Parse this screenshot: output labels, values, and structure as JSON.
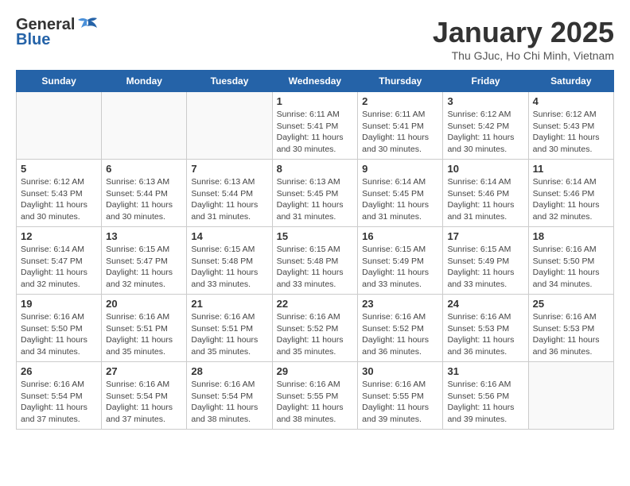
{
  "header": {
    "logo_general": "General",
    "logo_blue": "Blue",
    "title": "January 2025",
    "subtitle": "Thu GJuc, Ho Chi Minh, Vietnam"
  },
  "days_of_week": [
    "Sunday",
    "Monday",
    "Tuesday",
    "Wednesday",
    "Thursday",
    "Friday",
    "Saturday"
  ],
  "weeks": [
    [
      {
        "day": "",
        "info": ""
      },
      {
        "day": "",
        "info": ""
      },
      {
        "day": "",
        "info": ""
      },
      {
        "day": "1",
        "info": "Sunrise: 6:11 AM\nSunset: 5:41 PM\nDaylight: 11 hours\nand 30 minutes."
      },
      {
        "day": "2",
        "info": "Sunrise: 6:11 AM\nSunset: 5:41 PM\nDaylight: 11 hours\nand 30 minutes."
      },
      {
        "day": "3",
        "info": "Sunrise: 6:12 AM\nSunset: 5:42 PM\nDaylight: 11 hours\nand 30 minutes."
      },
      {
        "day": "4",
        "info": "Sunrise: 6:12 AM\nSunset: 5:43 PM\nDaylight: 11 hours\nand 30 minutes."
      }
    ],
    [
      {
        "day": "5",
        "info": "Sunrise: 6:12 AM\nSunset: 5:43 PM\nDaylight: 11 hours\nand 30 minutes."
      },
      {
        "day": "6",
        "info": "Sunrise: 6:13 AM\nSunset: 5:44 PM\nDaylight: 11 hours\nand 30 minutes."
      },
      {
        "day": "7",
        "info": "Sunrise: 6:13 AM\nSunset: 5:44 PM\nDaylight: 11 hours\nand 31 minutes."
      },
      {
        "day": "8",
        "info": "Sunrise: 6:13 AM\nSunset: 5:45 PM\nDaylight: 11 hours\nand 31 minutes."
      },
      {
        "day": "9",
        "info": "Sunrise: 6:14 AM\nSunset: 5:45 PM\nDaylight: 11 hours\nand 31 minutes."
      },
      {
        "day": "10",
        "info": "Sunrise: 6:14 AM\nSunset: 5:46 PM\nDaylight: 11 hours\nand 31 minutes."
      },
      {
        "day": "11",
        "info": "Sunrise: 6:14 AM\nSunset: 5:46 PM\nDaylight: 11 hours\nand 32 minutes."
      }
    ],
    [
      {
        "day": "12",
        "info": "Sunrise: 6:14 AM\nSunset: 5:47 PM\nDaylight: 11 hours\nand 32 minutes."
      },
      {
        "day": "13",
        "info": "Sunrise: 6:15 AM\nSunset: 5:47 PM\nDaylight: 11 hours\nand 32 minutes."
      },
      {
        "day": "14",
        "info": "Sunrise: 6:15 AM\nSunset: 5:48 PM\nDaylight: 11 hours\nand 33 minutes."
      },
      {
        "day": "15",
        "info": "Sunrise: 6:15 AM\nSunset: 5:48 PM\nDaylight: 11 hours\nand 33 minutes."
      },
      {
        "day": "16",
        "info": "Sunrise: 6:15 AM\nSunset: 5:49 PM\nDaylight: 11 hours\nand 33 minutes."
      },
      {
        "day": "17",
        "info": "Sunrise: 6:15 AM\nSunset: 5:49 PM\nDaylight: 11 hours\nand 33 minutes."
      },
      {
        "day": "18",
        "info": "Sunrise: 6:16 AM\nSunset: 5:50 PM\nDaylight: 11 hours\nand 34 minutes."
      }
    ],
    [
      {
        "day": "19",
        "info": "Sunrise: 6:16 AM\nSunset: 5:50 PM\nDaylight: 11 hours\nand 34 minutes."
      },
      {
        "day": "20",
        "info": "Sunrise: 6:16 AM\nSunset: 5:51 PM\nDaylight: 11 hours\nand 35 minutes."
      },
      {
        "day": "21",
        "info": "Sunrise: 6:16 AM\nSunset: 5:51 PM\nDaylight: 11 hours\nand 35 minutes."
      },
      {
        "day": "22",
        "info": "Sunrise: 6:16 AM\nSunset: 5:52 PM\nDaylight: 11 hours\nand 35 minutes."
      },
      {
        "day": "23",
        "info": "Sunrise: 6:16 AM\nSunset: 5:52 PM\nDaylight: 11 hours\nand 36 minutes."
      },
      {
        "day": "24",
        "info": "Sunrise: 6:16 AM\nSunset: 5:53 PM\nDaylight: 11 hours\nand 36 minutes."
      },
      {
        "day": "25",
        "info": "Sunrise: 6:16 AM\nSunset: 5:53 PM\nDaylight: 11 hours\nand 36 minutes."
      }
    ],
    [
      {
        "day": "26",
        "info": "Sunrise: 6:16 AM\nSunset: 5:54 PM\nDaylight: 11 hours\nand 37 minutes."
      },
      {
        "day": "27",
        "info": "Sunrise: 6:16 AM\nSunset: 5:54 PM\nDaylight: 11 hours\nand 37 minutes."
      },
      {
        "day": "28",
        "info": "Sunrise: 6:16 AM\nSunset: 5:54 PM\nDaylight: 11 hours\nand 38 minutes."
      },
      {
        "day": "29",
        "info": "Sunrise: 6:16 AM\nSunset: 5:55 PM\nDaylight: 11 hours\nand 38 minutes."
      },
      {
        "day": "30",
        "info": "Sunrise: 6:16 AM\nSunset: 5:55 PM\nDaylight: 11 hours\nand 39 minutes."
      },
      {
        "day": "31",
        "info": "Sunrise: 6:16 AM\nSunset: 5:56 PM\nDaylight: 11 hours\nand 39 minutes."
      },
      {
        "day": "",
        "info": ""
      }
    ]
  ]
}
